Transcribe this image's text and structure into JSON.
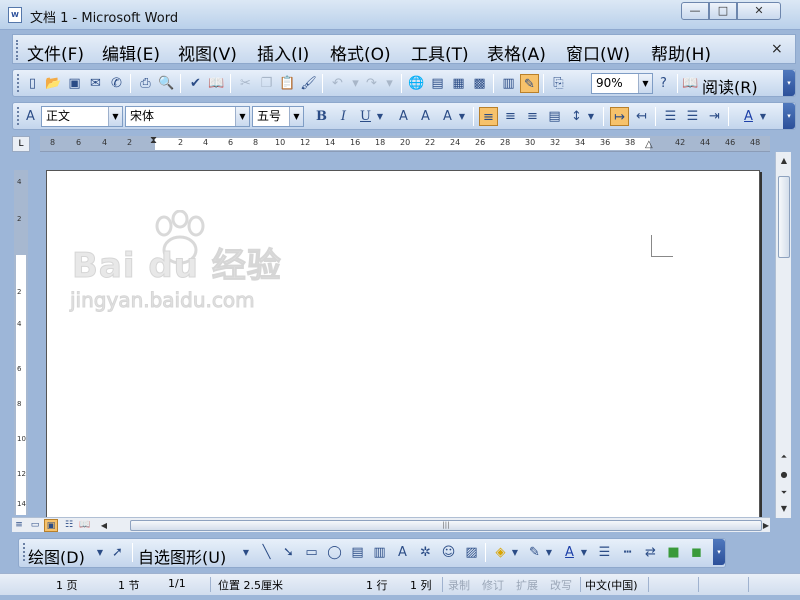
{
  "window": {
    "icon_label": "W",
    "title": "文档 1 - Microsoft Word",
    "minimize": "—",
    "maximize": "□",
    "close": "✕"
  },
  "menu": {
    "items": [
      "文件(F)",
      "编辑(E)",
      "视图(V)",
      "插入(I)",
      "格式(O)",
      "工具(T)",
      "表格(A)",
      "窗口(W)",
      "帮助(H)"
    ],
    "close": "×"
  },
  "standard_toolbar": {
    "zoom": "90%",
    "read_label": "阅读(R)"
  },
  "format_toolbar": {
    "style": "正文",
    "font": "宋体",
    "size": "五号",
    "bold": "B",
    "italic": "I",
    "underline": "U",
    "font_color_letter": "A"
  },
  "ruler": {
    "corner": "L",
    "h_ticks": [
      "8",
      "6",
      "4",
      "2",
      "2",
      "4",
      "6",
      "8",
      "10",
      "12",
      "14",
      "16",
      "18",
      "20",
      "22",
      "24",
      "26",
      "28",
      "30",
      "32",
      "34",
      "36",
      "38",
      "42",
      "44",
      "46",
      "48"
    ],
    "v_ticks": [
      "4",
      "2",
      "2",
      "4",
      "6",
      "8",
      "10",
      "12",
      "14"
    ]
  },
  "watermark": {
    "brand": "Bai du 经验",
    "url": "jingyan.baidu.com"
  },
  "draw_toolbar": {
    "draw_label": "绘图(D)",
    "autoshape_label": "自选图形(U)"
  },
  "status": {
    "page": "1 页",
    "section": "1 节",
    "page_of": "1/1",
    "position": "位置 2.5厘米",
    "line": "1 行",
    "column": "1 列",
    "rec": "录制",
    "trk": "修订",
    "ext": "扩展",
    "ovr": "改写",
    "language": "中文(中国)"
  },
  "colors": {
    "accent": "#f7c26b",
    "toolbar": "#c3d5ec",
    "workspace": "#9db6d8"
  }
}
